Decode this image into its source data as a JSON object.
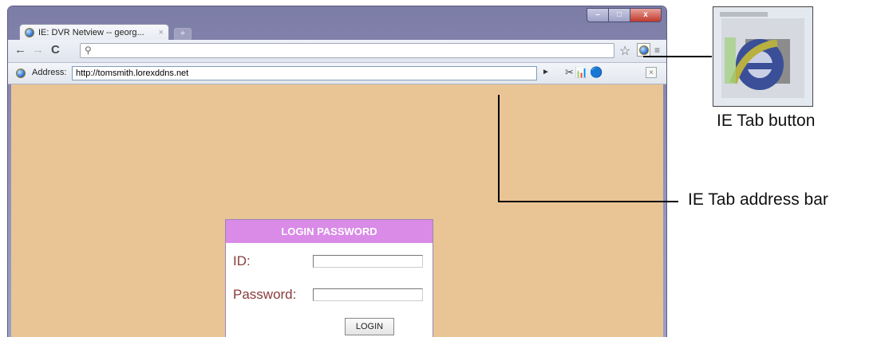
{
  "browser": {
    "tab_title": "IE: DVR Netview -- georg...",
    "tab_close": "×",
    "new_tab": "+",
    "window_controls": {
      "minimize": "–",
      "maximize": "□",
      "close": "x"
    },
    "nav": {
      "back": "←",
      "forward": "→",
      "reload": "C",
      "search_icon": "⚲",
      "star": "☆",
      "wrench": "≡"
    },
    "ietab_bar": {
      "label": "Address:",
      "url": "http://tomsmith.lorexddns.net",
      "go": "►",
      "tools": "✂📊🔵",
      "close": "×"
    }
  },
  "login": {
    "title": "LOGIN PASSWORD",
    "id_label": "ID:",
    "password_label": "Password:",
    "button": "LOGIN"
  },
  "callouts": {
    "button_label": "IE Tab button",
    "address_label": "IE Tab address bar"
  },
  "colors": {
    "page_bg": "#e9c595",
    "login_header": "#d98be7",
    "label_text": "#8a3b3b"
  }
}
